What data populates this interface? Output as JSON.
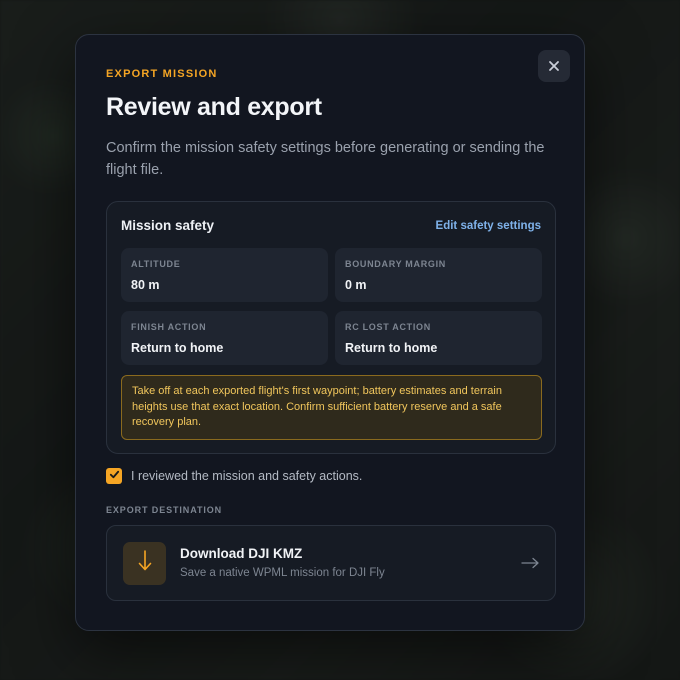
{
  "modal": {
    "eyebrow": "EXPORT MISSION",
    "title": "Review and export",
    "description": "Confirm the mission safety settings before generating or sending the flight file."
  },
  "safety": {
    "title": "Mission safety",
    "edit_label": "Edit safety settings",
    "stats": [
      {
        "label": "ALTITUDE",
        "value": "80 m"
      },
      {
        "label": "BOUNDARY MARGIN",
        "value": "0 m"
      },
      {
        "label": "FINISH ACTION",
        "value": "Return to home"
      },
      {
        "label": "RC LOST ACTION",
        "value": "Return to home"
      }
    ],
    "warning": "Take off at each exported flight's first waypoint; battery estimates and terrain heights use that exact location. Confirm sufficient battery reserve and a safe recovery plan."
  },
  "review": {
    "label": "I reviewed the mission and safety actions.",
    "checked": true
  },
  "export": {
    "section_label": "EXPORT DESTINATION",
    "download_title": "Download DJI KMZ",
    "download_subtitle": "Save a native WPML mission for DJI Fly"
  },
  "icons": {
    "close": "close-icon",
    "check": "check-icon",
    "download": "download-arrow-icon",
    "go": "arrow-right-icon"
  },
  "colors": {
    "accent": "#f5a524",
    "link": "#7fb2ea",
    "warning_text": "#f1c65c",
    "modal_bg": "#121620"
  }
}
